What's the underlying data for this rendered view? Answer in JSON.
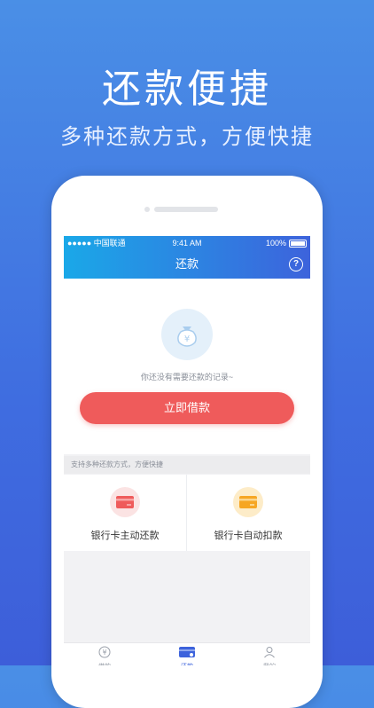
{
  "hero": {
    "title": "还款便捷",
    "subtitle": "多种还款方式，方便快捷"
  },
  "status_bar": {
    "carrier": "●●●●● 中国联通",
    "time": "9:41 AM",
    "battery": "100%"
  },
  "nav": {
    "title": "还款",
    "help_icon": "question-mark-icon"
  },
  "empty_state": {
    "icon": "money-bag-icon",
    "text": "你还没有需要还款的记录~"
  },
  "borrow_button": {
    "label": "立即借款"
  },
  "methods": {
    "header": "支持多种还款方式，方便快捷",
    "items": [
      {
        "label": "银行卡主动还款",
        "icon": "bank-card-icon",
        "color": "#ef5b5b"
      },
      {
        "label": "银行卡自动扣款",
        "icon": "bank-card-icon",
        "color": "#f6a623"
      }
    ]
  },
  "tabbar": {
    "tabs": [
      {
        "label": "借款",
        "icon": "yen-circle-icon"
      },
      {
        "label": "还款",
        "icon": "card-tab-icon"
      },
      {
        "label": "我的",
        "icon": "user-icon"
      }
    ]
  },
  "colors": {
    "background": "#4a8fe6",
    "nav_gradient_start": "#1aa8e8",
    "nav_gradient_end": "#3d63dc",
    "primary_button": "#ef5b5b"
  }
}
